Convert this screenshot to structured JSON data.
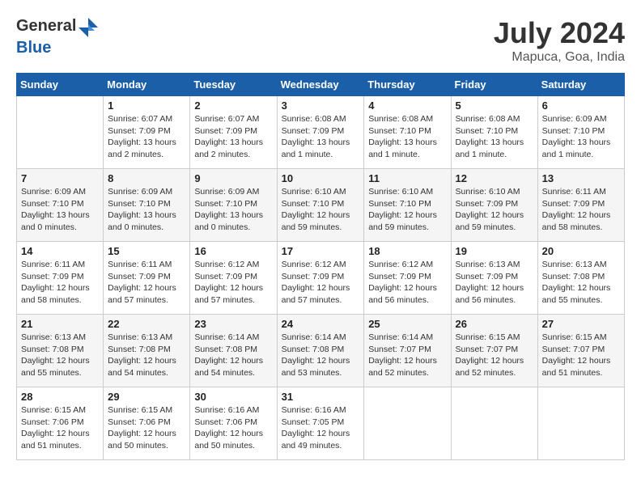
{
  "header": {
    "logo": {
      "general": "General",
      "blue": "Blue"
    },
    "title": "July 2024",
    "location": "Mapuca, Goa, India"
  },
  "columns": [
    "Sunday",
    "Monday",
    "Tuesday",
    "Wednesday",
    "Thursday",
    "Friday",
    "Saturday"
  ],
  "weeks": [
    [
      {
        "empty": true
      },
      {
        "day": "1",
        "sunrise": "6:07 AM",
        "sunset": "7:09 PM",
        "daylight": "13 hours and 2 minutes."
      },
      {
        "day": "2",
        "sunrise": "6:07 AM",
        "sunset": "7:09 PM",
        "daylight": "13 hours and 2 minutes."
      },
      {
        "day": "3",
        "sunrise": "6:08 AM",
        "sunset": "7:09 PM",
        "daylight": "13 hours and 1 minute."
      },
      {
        "day": "4",
        "sunrise": "6:08 AM",
        "sunset": "7:10 PM",
        "daylight": "13 hours and 1 minute."
      },
      {
        "day": "5",
        "sunrise": "6:08 AM",
        "sunset": "7:10 PM",
        "daylight": "13 hours and 1 minute."
      },
      {
        "day": "6",
        "sunrise": "6:09 AM",
        "sunset": "7:10 PM",
        "daylight": "13 hours and 1 minute."
      }
    ],
    [
      {
        "day": "7",
        "sunrise": "6:09 AM",
        "sunset": "7:10 PM",
        "daylight": "13 hours and 0 minutes."
      },
      {
        "day": "8",
        "sunrise": "6:09 AM",
        "sunset": "7:10 PM",
        "daylight": "13 hours and 0 minutes."
      },
      {
        "day": "9",
        "sunrise": "6:09 AM",
        "sunset": "7:10 PM",
        "daylight": "13 hours and 0 minutes."
      },
      {
        "day": "10",
        "sunrise": "6:10 AM",
        "sunset": "7:10 PM",
        "daylight": "12 hours and 59 minutes."
      },
      {
        "day": "11",
        "sunrise": "6:10 AM",
        "sunset": "7:10 PM",
        "daylight": "12 hours and 59 minutes."
      },
      {
        "day": "12",
        "sunrise": "6:10 AM",
        "sunset": "7:09 PM",
        "daylight": "12 hours and 59 minutes."
      },
      {
        "day": "13",
        "sunrise": "6:11 AM",
        "sunset": "7:09 PM",
        "daylight": "12 hours and 58 minutes."
      }
    ],
    [
      {
        "day": "14",
        "sunrise": "6:11 AM",
        "sunset": "7:09 PM",
        "daylight": "12 hours and 58 minutes."
      },
      {
        "day": "15",
        "sunrise": "6:11 AM",
        "sunset": "7:09 PM",
        "daylight": "12 hours and 57 minutes."
      },
      {
        "day": "16",
        "sunrise": "6:12 AM",
        "sunset": "7:09 PM",
        "daylight": "12 hours and 57 minutes."
      },
      {
        "day": "17",
        "sunrise": "6:12 AM",
        "sunset": "7:09 PM",
        "daylight": "12 hours and 57 minutes."
      },
      {
        "day": "18",
        "sunrise": "6:12 AM",
        "sunset": "7:09 PM",
        "daylight": "12 hours and 56 minutes."
      },
      {
        "day": "19",
        "sunrise": "6:13 AM",
        "sunset": "7:09 PM",
        "daylight": "12 hours and 56 minutes."
      },
      {
        "day": "20",
        "sunrise": "6:13 AM",
        "sunset": "7:08 PM",
        "daylight": "12 hours and 55 minutes."
      }
    ],
    [
      {
        "day": "21",
        "sunrise": "6:13 AM",
        "sunset": "7:08 PM",
        "daylight": "12 hours and 55 minutes."
      },
      {
        "day": "22",
        "sunrise": "6:13 AM",
        "sunset": "7:08 PM",
        "daylight": "12 hours and 54 minutes."
      },
      {
        "day": "23",
        "sunrise": "6:14 AM",
        "sunset": "7:08 PM",
        "daylight": "12 hours and 54 minutes."
      },
      {
        "day": "24",
        "sunrise": "6:14 AM",
        "sunset": "7:08 PM",
        "daylight": "12 hours and 53 minutes."
      },
      {
        "day": "25",
        "sunrise": "6:14 AM",
        "sunset": "7:07 PM",
        "daylight": "12 hours and 52 minutes."
      },
      {
        "day": "26",
        "sunrise": "6:15 AM",
        "sunset": "7:07 PM",
        "daylight": "12 hours and 52 minutes."
      },
      {
        "day": "27",
        "sunrise": "6:15 AM",
        "sunset": "7:07 PM",
        "daylight": "12 hours and 51 minutes."
      }
    ],
    [
      {
        "day": "28",
        "sunrise": "6:15 AM",
        "sunset": "7:06 PM",
        "daylight": "12 hours and 51 minutes."
      },
      {
        "day": "29",
        "sunrise": "6:15 AM",
        "sunset": "7:06 PM",
        "daylight": "12 hours and 50 minutes."
      },
      {
        "day": "30",
        "sunrise": "6:16 AM",
        "sunset": "7:06 PM",
        "daylight": "12 hours and 50 minutes."
      },
      {
        "day": "31",
        "sunrise": "6:16 AM",
        "sunset": "7:05 PM",
        "daylight": "12 hours and 49 minutes."
      },
      {
        "empty": true
      },
      {
        "empty": true
      },
      {
        "empty": true
      }
    ]
  ],
  "labels": {
    "sunrise_prefix": "Sunrise: ",
    "sunset_prefix": "Sunset: ",
    "daylight_prefix": "Daylight: "
  }
}
